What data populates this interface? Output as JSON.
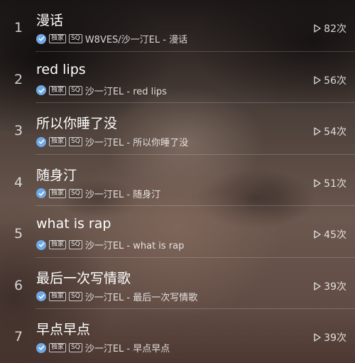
{
  "tracks": [
    {
      "index": "1",
      "title": "漫话",
      "exclusive": "独家",
      "quality": "SQ",
      "subtitle": "W8VES/沙一汀EL - 漫话",
      "plays": "82次"
    },
    {
      "index": "2",
      "title": "red lips",
      "exclusive": "独家",
      "quality": "SQ",
      "subtitle": "沙一汀EL - red lips",
      "plays": "56次"
    },
    {
      "index": "3",
      "title": "所以你睡了没",
      "exclusive": "独家",
      "quality": "SQ",
      "subtitle": "沙一汀EL - 所以你睡了没",
      "plays": "54次"
    },
    {
      "index": "4",
      "title": "随身汀",
      "exclusive": "独家",
      "quality": "SQ",
      "subtitle": "沙一汀EL - 随身汀",
      "plays": "51次"
    },
    {
      "index": "5",
      "title": "what is rap",
      "exclusive": "独家",
      "quality": "SQ",
      "subtitle": "沙一汀EL - what is rap",
      "plays": "45次"
    },
    {
      "index": "6",
      "title": "最后一次写情歌",
      "exclusive": "独家",
      "quality": "SQ",
      "subtitle": "沙一汀EL - 最后一次写情歌",
      "plays": "39次"
    },
    {
      "index": "7",
      "title": "早点早点",
      "exclusive": "独家",
      "quality": "SQ",
      "subtitle": "沙一汀EL - 早点早点",
      "plays": "39次"
    }
  ],
  "icons": {
    "verified": "check-badge-icon",
    "plays": "play-triangle-icon"
  },
  "colors": {
    "verified_badge": "#6fa9e6"
  }
}
